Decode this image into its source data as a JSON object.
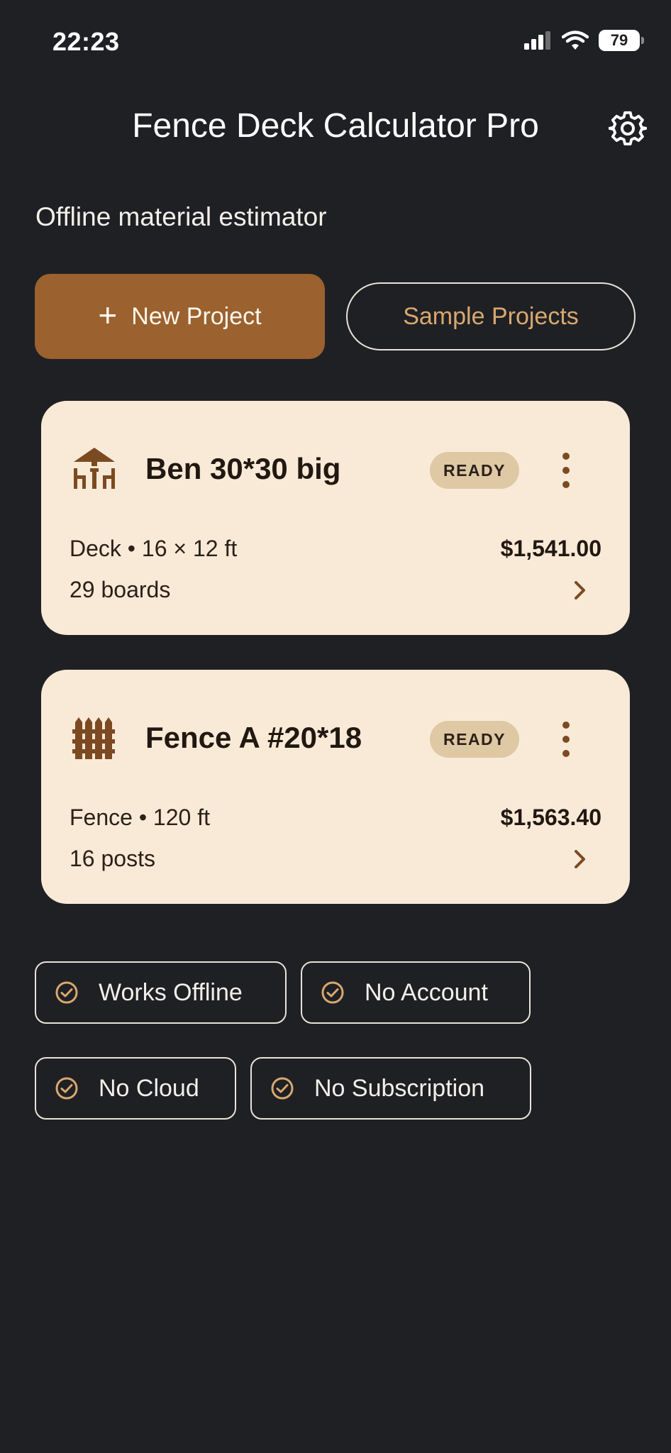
{
  "status": {
    "time": "22:23",
    "battery": "79"
  },
  "header": {
    "title": "Fence Deck Calculator Pro"
  },
  "subtitle": "Offline material estimator",
  "actions": {
    "new_project": "New Project",
    "sample_projects": "Sample Projects"
  },
  "projects": [
    {
      "name": "Ben 30*30 big",
      "icon": "deck-icon",
      "status": "READY",
      "meta": "Deck • 16 × 12 ft",
      "price": "$1,541.00",
      "detail": "29 boards"
    },
    {
      "name": "Fence A #20*18",
      "icon": "fence-icon",
      "status": "READY",
      "meta": "Fence • 120 ft",
      "price": "$1,563.40",
      "detail": "16 posts"
    }
  ],
  "features": [
    "Works Offline",
    "No Account",
    "No Cloud",
    "No Subscription"
  ],
  "colors": {
    "background": "#1f2024",
    "accent": "#9b612f",
    "card": "#f9ead7",
    "accent_text": "#d8a86e",
    "badge": "#dfc8a4"
  }
}
